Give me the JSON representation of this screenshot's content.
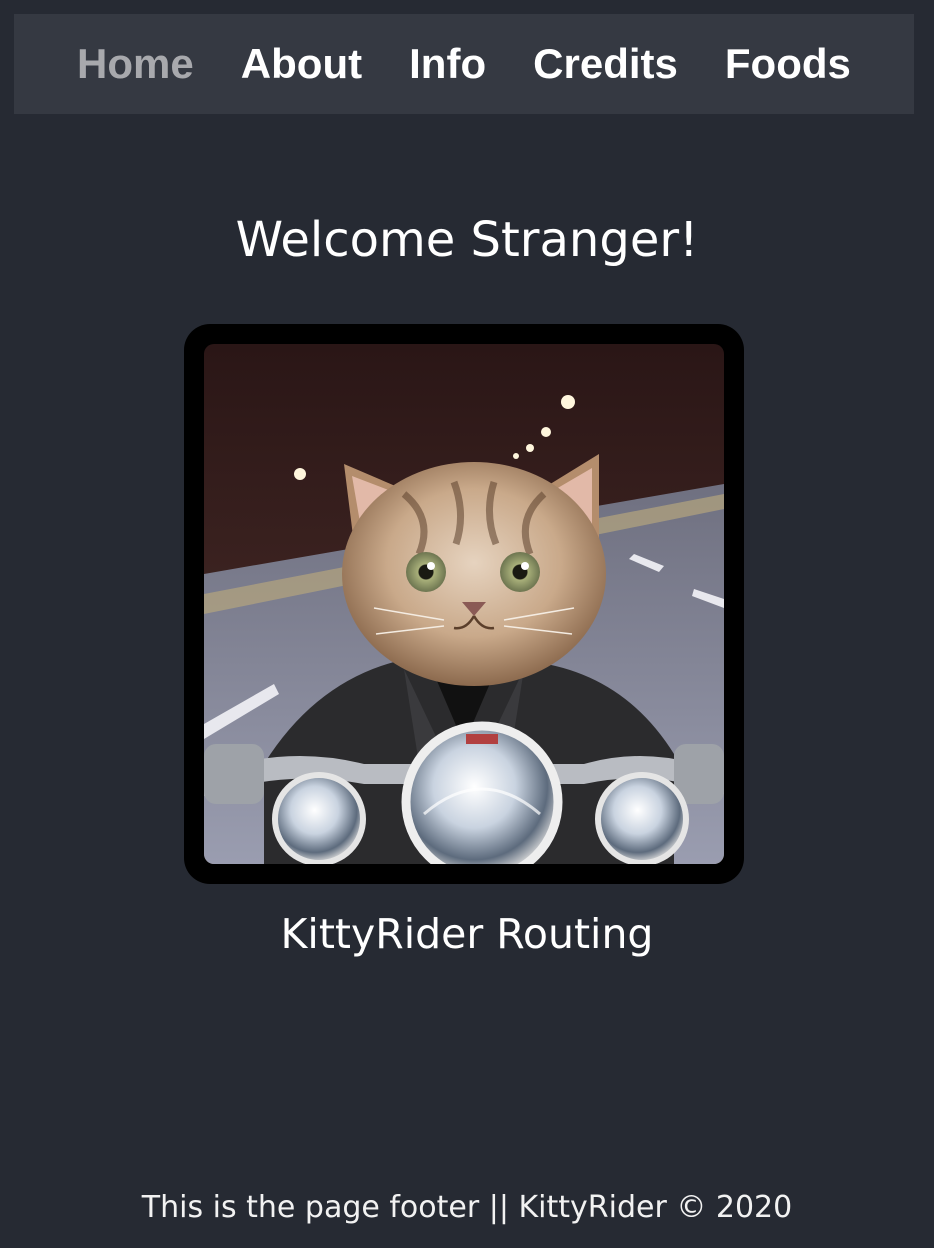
{
  "nav": {
    "items": [
      {
        "label": "Home",
        "active": true
      },
      {
        "label": "About",
        "active": false
      },
      {
        "label": "Info",
        "active": false
      },
      {
        "label": "Credits",
        "active": false
      },
      {
        "label": "Foods",
        "active": false
      }
    ]
  },
  "main": {
    "heading": "Welcome Stranger!",
    "image_subject": "kitten-riding-motorcycle",
    "caption": "KittyRider Routing"
  },
  "footer": {
    "text": "This is the page footer || KittyRider © 2020"
  },
  "colors": {
    "background": "#262a33",
    "navbar": "#353942",
    "nav_text": "#ffffff",
    "nav_active_text": "#a8a9ad",
    "frame": "#000000"
  }
}
